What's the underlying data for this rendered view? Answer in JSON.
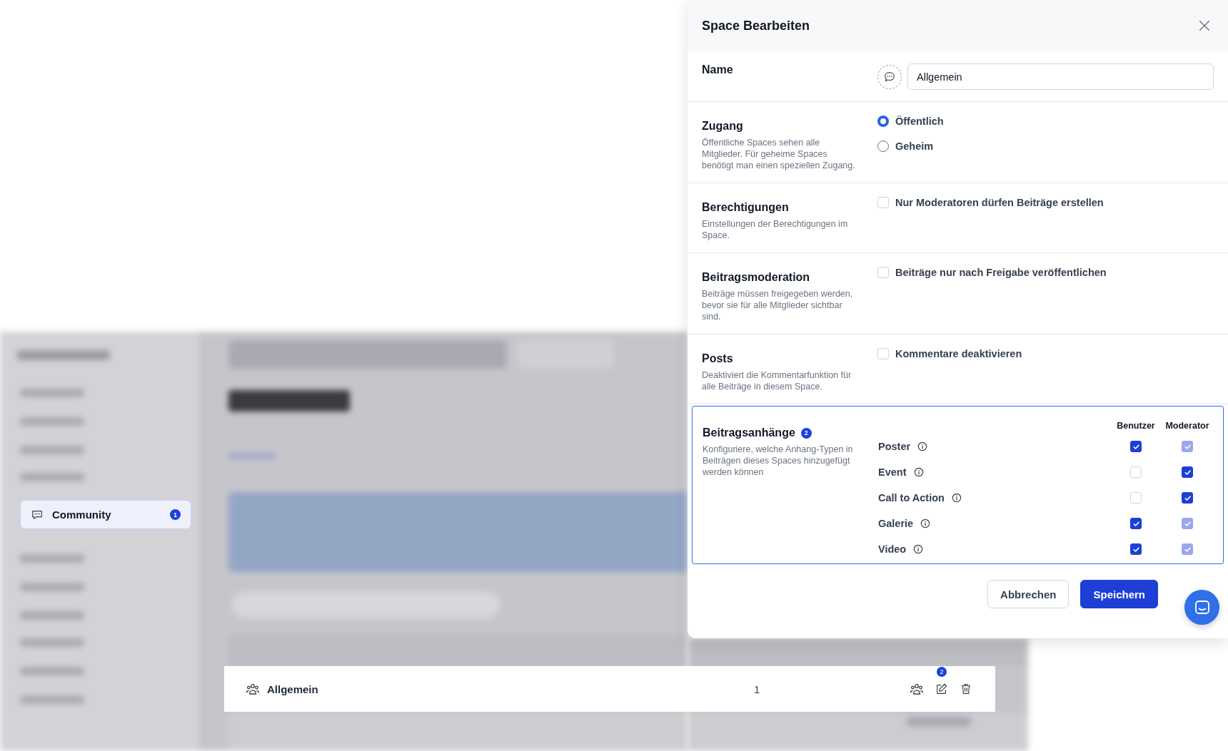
{
  "backdrop": {
    "sidebar_item": {
      "label": "Community",
      "badge": "1",
      "selected": true
    },
    "row": {
      "name": "Allgemein",
      "posts": "1",
      "edit_badge": "2"
    }
  },
  "dialog": {
    "title": "Space Bearbeiten",
    "sections": [
      {
        "kind": "name",
        "title": "Name",
        "value": "Allgemein"
      },
      {
        "kind": "radio",
        "title": "Zugang",
        "description": "Öffentliche Spaces sehen alle Mitglieder. Für geheime Spaces benötigt man einen speziellen Zugang.",
        "options": [
          {
            "label": "Öffentlich",
            "selected": true
          },
          {
            "label": "Geheim",
            "selected": false
          }
        ]
      },
      {
        "kind": "checkbox",
        "title": "Berechtigungen",
        "description": "Einstellungen der Berechtigungen im Space.",
        "options": [
          {
            "label": "Nur Moderatoren dürfen Beiträge erstellen",
            "checked": false
          }
        ]
      },
      {
        "kind": "checkbox",
        "title": "Beitragsmoderation",
        "description": "Beiträge müssen freigegeben werden, bevor sie für alle Mitglieder sichtbar sind.",
        "options": [
          {
            "label": "Beiträge nur nach Freigabe veröffentlichen",
            "checked": false
          }
        ]
      },
      {
        "kind": "checkbox",
        "title": "Posts",
        "description": "Deaktiviert die Kommentarfunktion für alle Beiträge in diesem Space.",
        "options": [
          {
            "label": "Kommentare deaktivieren",
            "checked": false
          }
        ]
      },
      {
        "kind": "attachments",
        "title": "Beitragsanhänge",
        "badge": "2",
        "highlighted": true,
        "description": "Konfiguriere, welche Anhang-Typen in Beiträgen dieses Spaces hinzugefügt werden können",
        "columns": [
          "Benutzer",
          "Moderator"
        ],
        "rows": [
          {
            "label": "Poster",
            "user": {
              "checked": true,
              "disabled": false
            },
            "moderator": {
              "checked": true,
              "disabled": true
            }
          },
          {
            "label": "Event",
            "user": {
              "checked": false,
              "disabled": false
            },
            "moderator": {
              "checked": true,
              "disabled": false
            }
          },
          {
            "label": "Call to Action",
            "user": {
              "checked": false,
              "disabled": false
            },
            "moderator": {
              "checked": true,
              "disabled": false
            }
          },
          {
            "label": "Galerie",
            "user": {
              "checked": true,
              "disabled": false
            },
            "moderator": {
              "checked": true,
              "disabled": true
            }
          },
          {
            "label": "Video",
            "user": {
              "checked": true,
              "disabled": false
            },
            "moderator": {
              "checked": true,
              "disabled": true
            }
          }
        ]
      }
    ],
    "buttons": [
      {
        "label": "Abbrechen",
        "kind": "secondary"
      },
      {
        "label": "Speichern",
        "kind": "primary"
      }
    ]
  }
}
